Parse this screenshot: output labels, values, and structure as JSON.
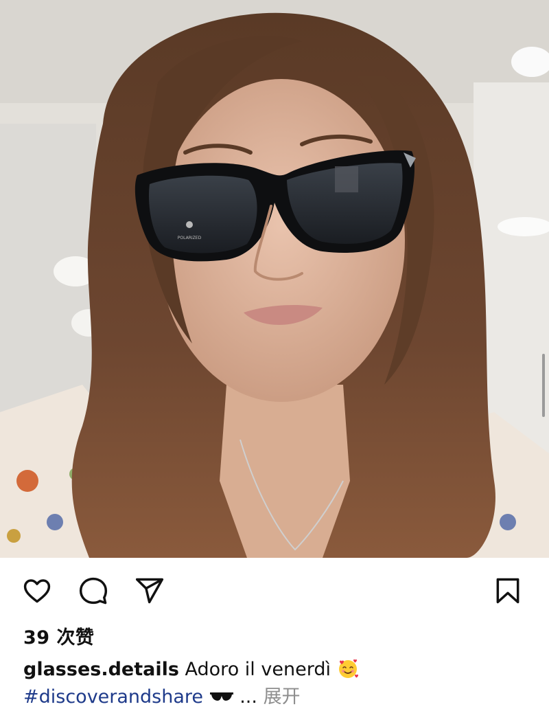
{
  "post": {
    "photo": {
      "subject": "selfie-with-sunglasses",
      "lens_logo": "POLARIZED"
    },
    "likes_text": "39 次赞",
    "caption": {
      "username": "glasses.details",
      "text": "Adoro il venerdì",
      "emoji": "smiling-face-with-hearts",
      "hashtag": "#discoverandshare",
      "sunglasses_emoji": "sunglasses",
      "ellipsis": "...",
      "more_label": "展开"
    }
  },
  "actions": {
    "like_icon": "heart-icon",
    "comment_icon": "comment-icon",
    "share_icon": "send-icon",
    "save_icon": "bookmark-icon"
  },
  "colors": {
    "hashtag": "#1e3a8a",
    "more": "#8e8e8e",
    "icons": "#111111"
  }
}
